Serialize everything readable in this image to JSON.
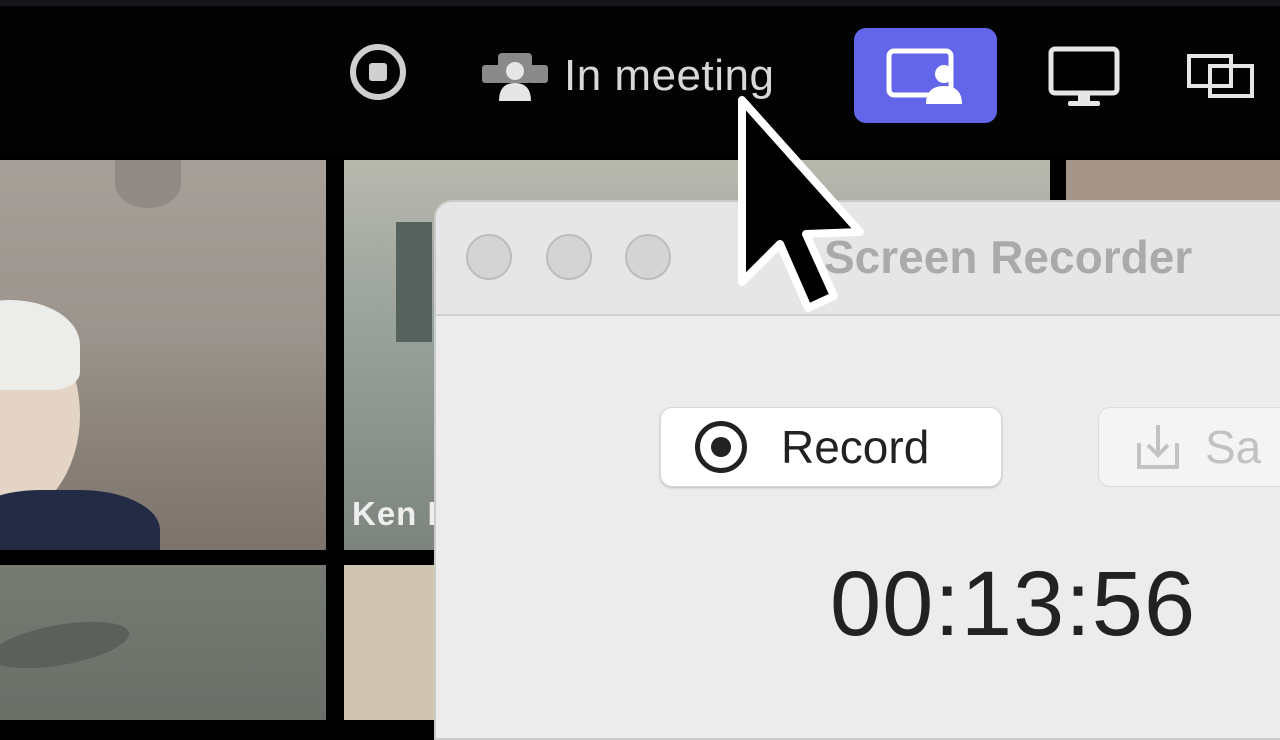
{
  "toolbar": {
    "status_label": "In meeting",
    "stop_icon": "stop-recording-icon",
    "status_icon": "participants-icon",
    "share_icon": "share-screen-icon",
    "monitor_icon": "monitor-icon",
    "screens_icon": "multiple-screens-icon",
    "accent_color": "#6366e8"
  },
  "gallery": {
    "participant_name": "Ken I"
  },
  "recorder": {
    "title": "Screen Recorder",
    "record_label": "Record",
    "save_label": "Sa",
    "timer": "00:13:56"
  },
  "cursor": {
    "icon": "mouse-pointer-icon"
  }
}
